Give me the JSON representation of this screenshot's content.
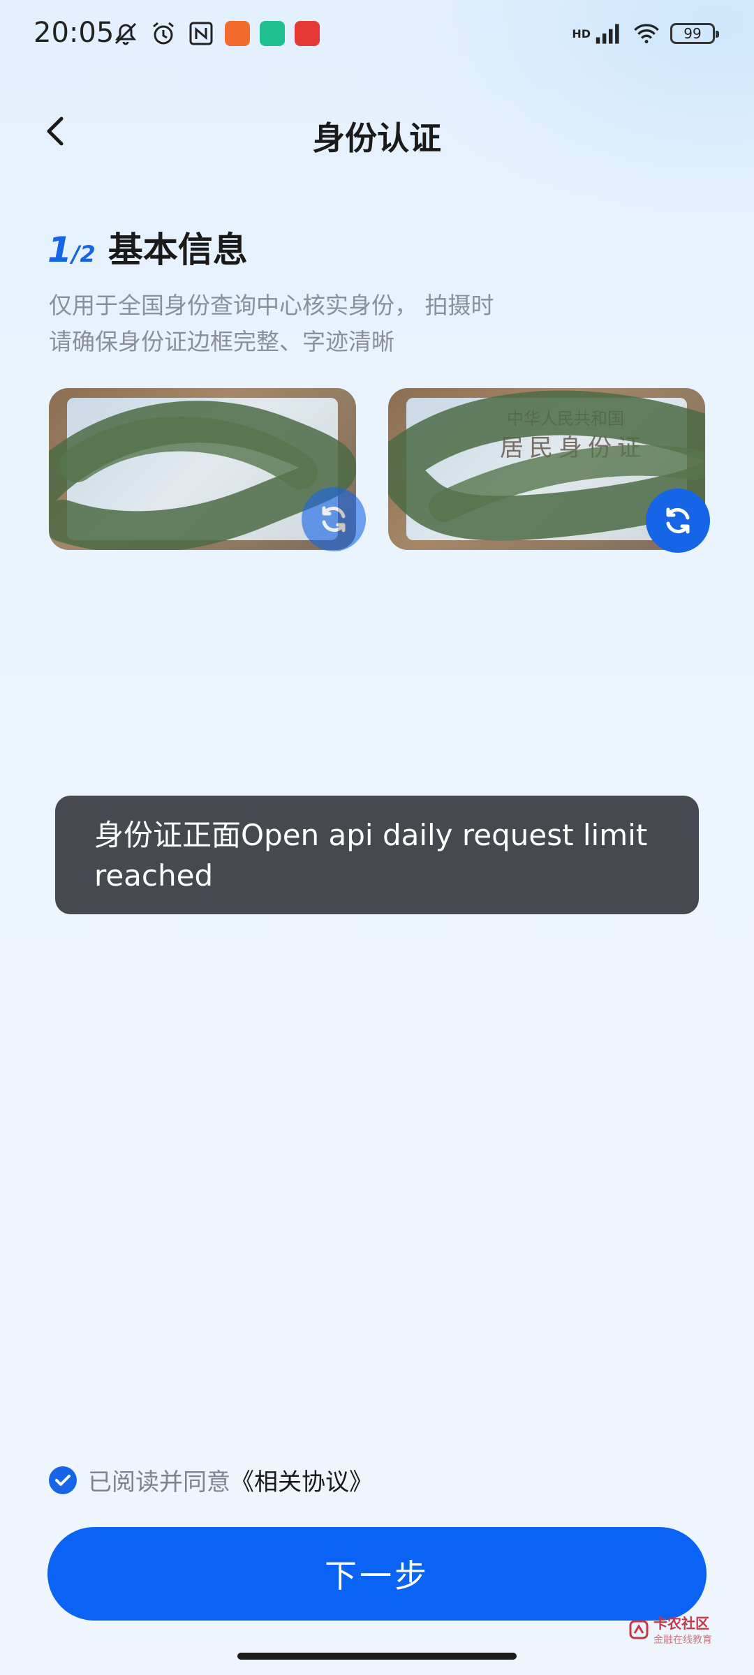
{
  "status_bar": {
    "time": "20:05",
    "network": "HD",
    "battery": "99",
    "icons": [
      "mute-icon",
      "alarm-icon",
      "nfc-icon",
      "app-icon-orange",
      "app-icon-green",
      "app-icon-red",
      "signal-icon",
      "wifi-icon",
      "battery-icon"
    ]
  },
  "header": {
    "title": "身份认证",
    "back_icon": "chevron-left-icon"
  },
  "step": {
    "current": "1",
    "total": "/2",
    "title": "基本信息"
  },
  "description": "仅用于全国身份查询中心核实身份， 拍摄时请确保身份证边框完整、字迹清晰",
  "id_back_card": {
    "text_line1": "中华人民共和国",
    "text_line2": "居民身份证"
  },
  "toast": {
    "message": "身份证正面Open api daily request limit reached"
  },
  "agreement": {
    "text": "已阅读并同意",
    "link": "《相关协议》",
    "checked": true
  },
  "next_button": {
    "label": "下一步"
  },
  "watermark": {
    "line1": "卡农社区",
    "line2": "金融在线教育"
  },
  "colors": {
    "primary": "#1565e6",
    "button": "#0b63f6",
    "toast_bg": "#464a50"
  }
}
